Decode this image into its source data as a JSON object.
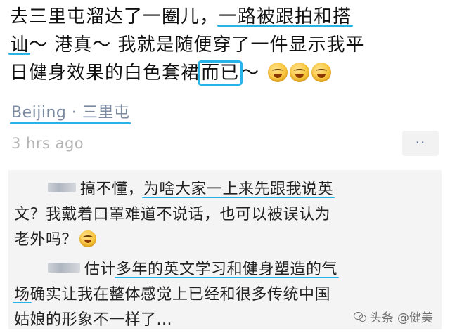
{
  "post": {
    "line1_a": "去三里屯溜达了一圈儿，",
    "line1_hl": "一路被跟拍和搭",
    "line2_hl": "讪",
    "line2_b": "～ 港真～ 我就是随便穿了一件显示我平",
    "line3_a": "日健身效果的白色套裙",
    "line3_box": "而已",
    "line3_c": "～",
    "emoji_names": [
      "laughing-crying-emoji",
      "laughing-crying-emoji",
      "laughing-crying-emoji"
    ]
  },
  "location": "Beijing · 三里屯",
  "time": "3 hrs ago",
  "more_label": "··",
  "comments": [
    {
      "text_a": "搞不懂，",
      "text_hl": "为啥大家一上来先跟我说英",
      "text_b": "文？我戴着口罩难道不说话，也可以被误认为",
      "text_c": "老外吗？",
      "emoji": "laughing-crying-emoji"
    },
    {
      "text_a": "估计",
      "text_hl1": "多年的英文学习和健身塑造的气",
      "text_hl2": "场",
      "text_b": "确实让我在整体感觉上已经和很多传统中国",
      "text_c": "姑娘的形象不一样了..."
    }
  ],
  "watermark": "头条 @健美"
}
